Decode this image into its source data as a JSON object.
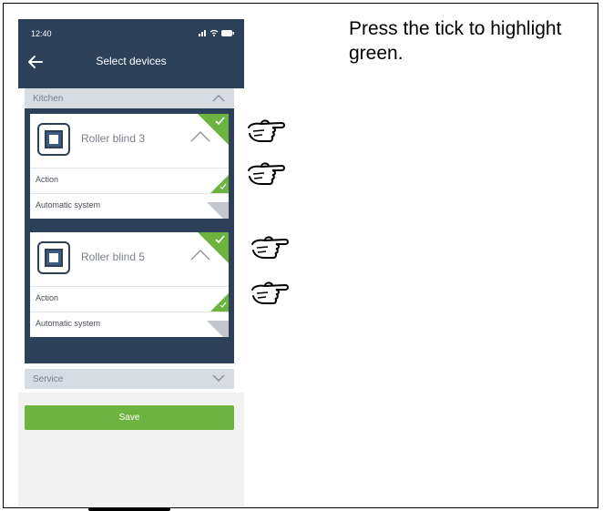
{
  "status_bar": {
    "time": "12:40"
  },
  "header": {
    "title": "Select devices"
  },
  "sections": [
    {
      "title": "Kitchen",
      "expanded": true,
      "devices": [
        {
          "name": "Roller blind 3",
          "selected": true,
          "options": [
            {
              "label": "Action",
              "selected": true
            },
            {
              "label": "Automatic system",
              "selected": false
            }
          ]
        },
        {
          "name": "Roller blind 5",
          "selected": true,
          "options": [
            {
              "label": "Action",
              "selected": true
            },
            {
              "label": "Automatic system",
              "selected": false
            }
          ]
        }
      ]
    },
    {
      "title": "Service",
      "expanded": false
    }
  ],
  "save_label": "Save",
  "instruction": "Press the tick to highlight green.",
  "colors": {
    "header_bg": "#2c4059",
    "accent_green": "#6db33f",
    "inactive_gray": "#c3c6cc",
    "section_bg": "#d7dbe2"
  },
  "icons": {
    "back": "arrow-left-icon",
    "collapse": "chevron-up-icon",
    "expand": "chevron-down-icon",
    "tick": "check-icon",
    "device": "roller-blind-icon",
    "pointer": "pointing-hand-icon"
  }
}
